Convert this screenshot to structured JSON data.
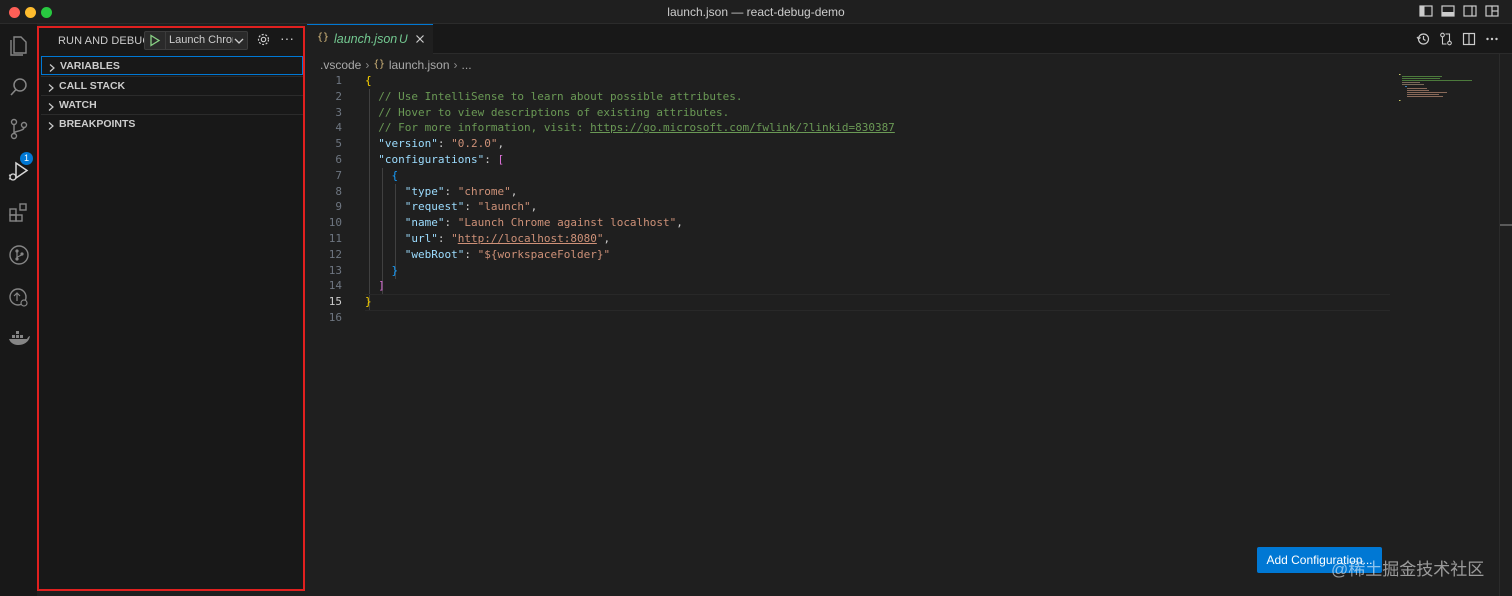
{
  "window": {
    "title": "launch.json — react-debug-demo"
  },
  "activity_bar": {
    "items": [
      "explorer-icon",
      "search-icon",
      "source-control-icon",
      "run-debug-icon",
      "extensions-icon",
      "git-graph-icon",
      "remote-explorer-icon",
      "docker-icon"
    ],
    "source_control_badge": "1"
  },
  "sidebar": {
    "title": "RUN AND DEBUG",
    "launch_config": "Launch Chrome",
    "sections": [
      {
        "label": "VARIABLES"
      },
      {
        "label": "CALL STACK"
      },
      {
        "label": "WATCH"
      },
      {
        "label": "BREAKPOINTS"
      }
    ]
  },
  "editor": {
    "tab": {
      "icon": "{}",
      "name": "launch.json",
      "status": "U"
    },
    "breadcrumb": {
      "folder": ".vscode",
      "file_icon": "{}",
      "file": "launch.json",
      "more": "..."
    },
    "lines": [
      {
        "n": "1"
      },
      {
        "n": "2"
      },
      {
        "n": "3"
      },
      {
        "n": "4"
      },
      {
        "n": "5"
      },
      {
        "n": "6"
      },
      {
        "n": "7"
      },
      {
        "n": "8"
      },
      {
        "n": "9"
      },
      {
        "n": "10"
      },
      {
        "n": "11"
      },
      {
        "n": "12"
      },
      {
        "n": "13"
      },
      {
        "n": "14"
      },
      {
        "n": "15"
      },
      {
        "n": "16"
      }
    ],
    "code": {
      "l1": "{",
      "l2": "// Use IntelliSense to learn about possible attributes.",
      "l3": "// Hover to view descriptions of existing attributes.",
      "l4_prefix": "// For more information, visit: ",
      "l4_link": "https://go.microsoft.com/fwlink/?linkid=830387",
      "l5_key": "\"version\"",
      "l5_val": "\"0.2.0\"",
      "l6_key": "\"configurations\"",
      "l6_br": "[",
      "l7": "{",
      "l8_key": "\"type\"",
      "l8_val": "\"chrome\"",
      "l9_key": "\"request\"",
      "l9_val": "\"launch\"",
      "l10_key": "\"name\"",
      "l10_val": "\"Launch Chrome against localhost\"",
      "l11_key": "\"url\"",
      "l11_q1": "\"",
      "l11_link": "http://localhost:8080",
      "l11_q2": "\"",
      "l12_key": "\"webRoot\"",
      "l12_val": "\"${workspaceFolder}\"",
      "l13": "}",
      "l14": "]",
      "l15": "}"
    },
    "add_configuration": "Add Configuration..."
  },
  "watermark": "@稀土掘金技术社区"
}
